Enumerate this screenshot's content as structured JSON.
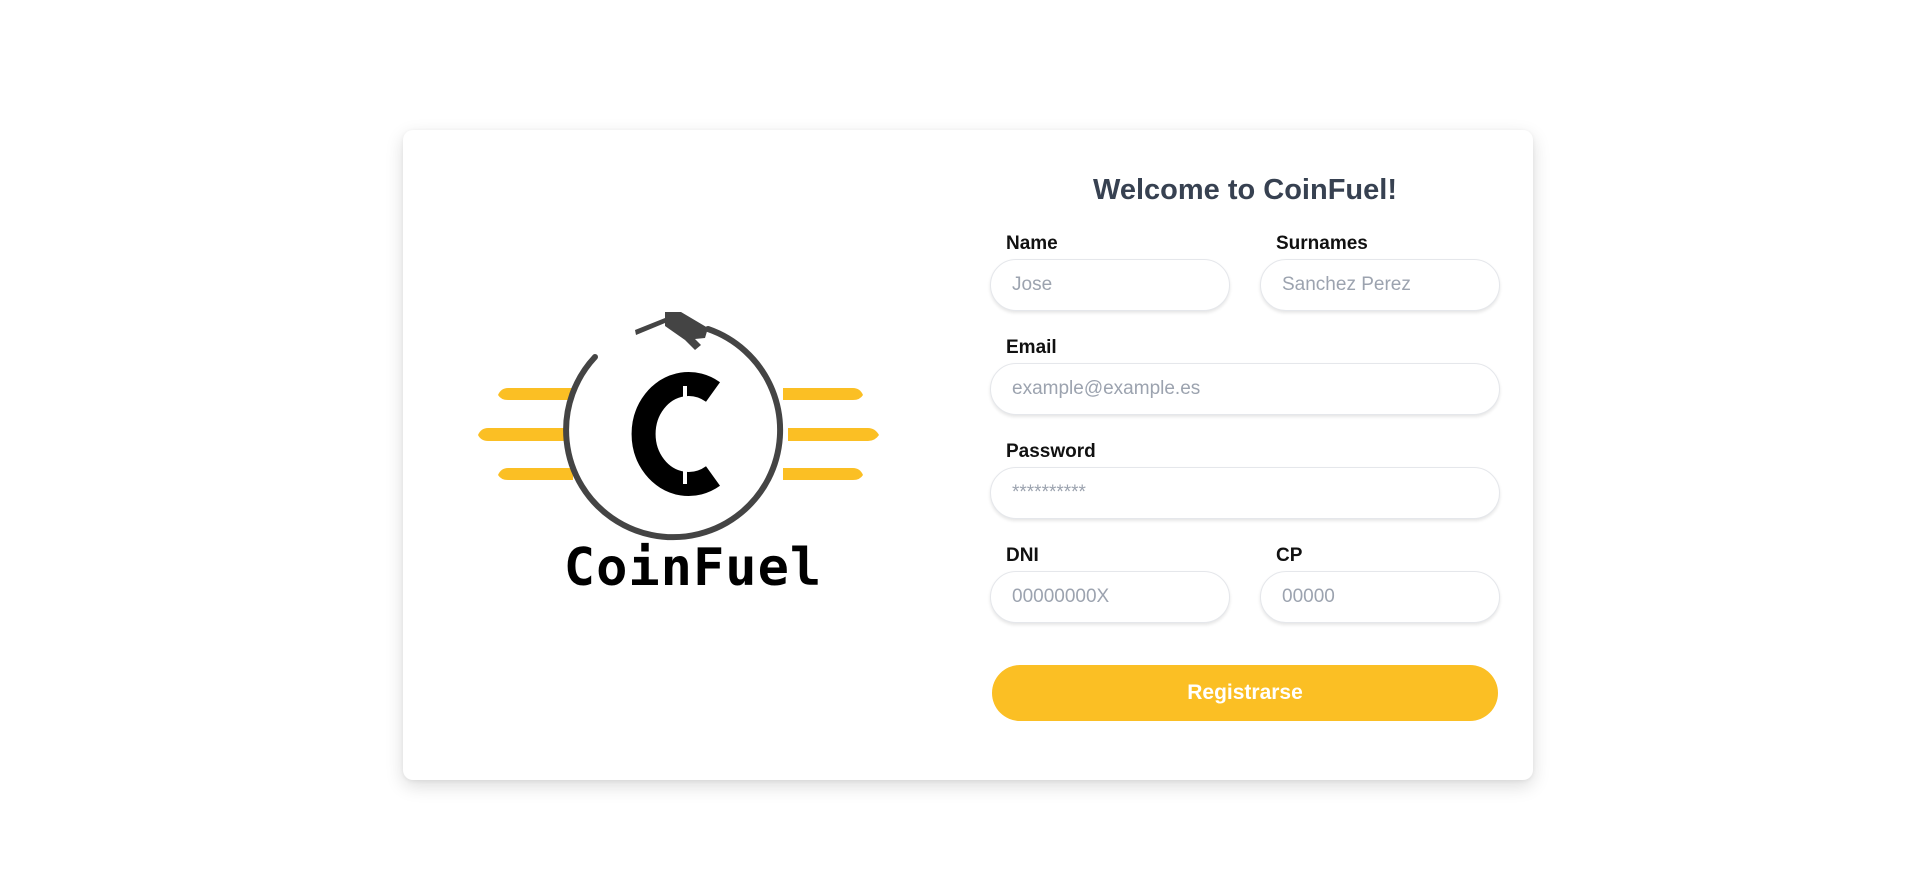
{
  "brand": {
    "name": "CoinFuel",
    "monogram": "C",
    "accent_color": "#fbbf24",
    "ring_color": "#444444"
  },
  "form": {
    "title": "Welcome to CoinFuel!",
    "fields": {
      "name": {
        "label": "Name",
        "placeholder": "Jose",
        "value": ""
      },
      "surnames": {
        "label": "Surnames",
        "placeholder": "Sanchez Perez",
        "value": ""
      },
      "email": {
        "label": "Email",
        "placeholder": "example@example.es",
        "value": ""
      },
      "password": {
        "label": "Password",
        "placeholder": "**********",
        "value": ""
      },
      "dni": {
        "label": "DNI",
        "placeholder": "00000000X",
        "value": ""
      },
      "cp": {
        "label": "CP",
        "placeholder": "00000",
        "value": ""
      }
    },
    "submit_label": "Registrarse",
    "submit_color": "#fbbf24"
  }
}
